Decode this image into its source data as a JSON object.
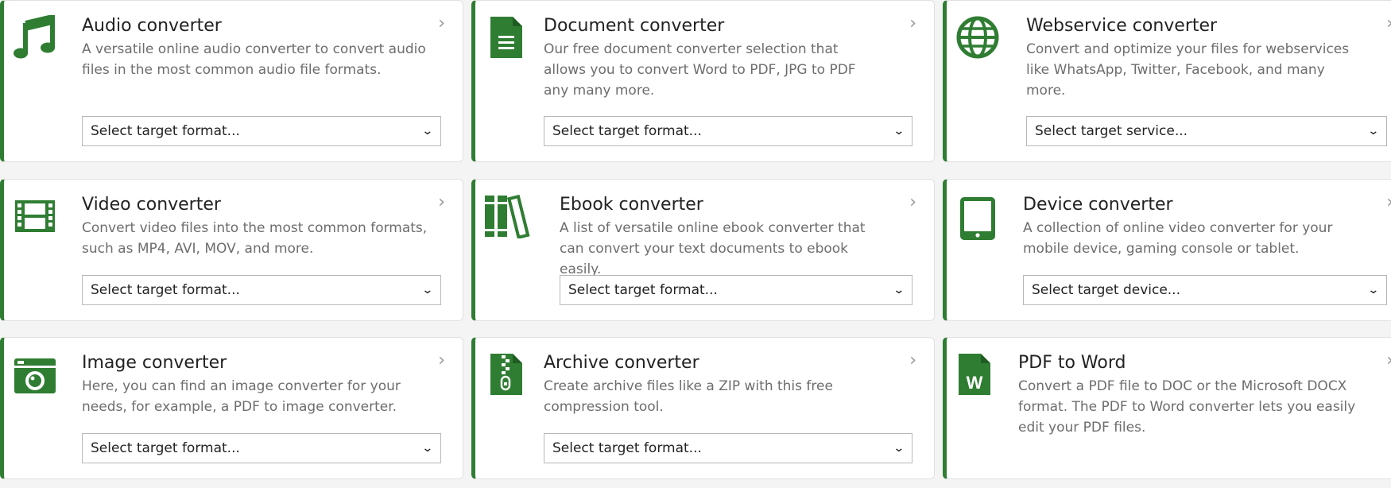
{
  "accent_color": "#2f7d32",
  "cards": [
    {
      "title": "Audio converter",
      "description": "A versatile online audio converter to convert audio files in the most common audio file formats.",
      "select": "Select target format...",
      "icon": "music-note-icon"
    },
    {
      "title": "Document converter",
      "description": "Our free document converter selection that allows you to convert Word to PDF, JPG to PDF any many more.",
      "select": "Select target format...",
      "icon": "document-icon"
    },
    {
      "title": "Webservice converter",
      "description": "Convert and optimize your files for webservices like WhatsApp, Twitter, Facebook, and many more.",
      "select": "Select target service...",
      "icon": "globe-icon"
    },
    {
      "title": "Video converter",
      "description": "Convert video files into the most common formats, such as MP4, AVI, MOV, and more.",
      "select": "Select target format...",
      "icon": "film-icon"
    },
    {
      "title": "Ebook converter",
      "description": "A list of versatile online ebook converter that can convert your text documents to ebook easily.",
      "select": "Select target format...",
      "icon": "books-icon"
    },
    {
      "title": "Device converter",
      "description": "A collection of online video converter for your mobile device, gaming console or tablet.",
      "select": "Select target device...",
      "icon": "tablet-icon"
    },
    {
      "title": "Image converter",
      "description": "Here, you can find an image converter for your needs, for example, a PDF to image converter.",
      "select": "Select target format...",
      "icon": "camera-icon"
    },
    {
      "title": "Archive converter",
      "description": "Create archive files like a ZIP with this free compression tool.",
      "select": "Select target format...",
      "icon": "zip-file-icon"
    },
    {
      "title": "PDF to Word",
      "description": "Convert a PDF file to DOC or the Microsoft DOCX format. The PDF to Word converter lets you easily edit your PDF files.",
      "icon": "word-file-icon"
    }
  ]
}
